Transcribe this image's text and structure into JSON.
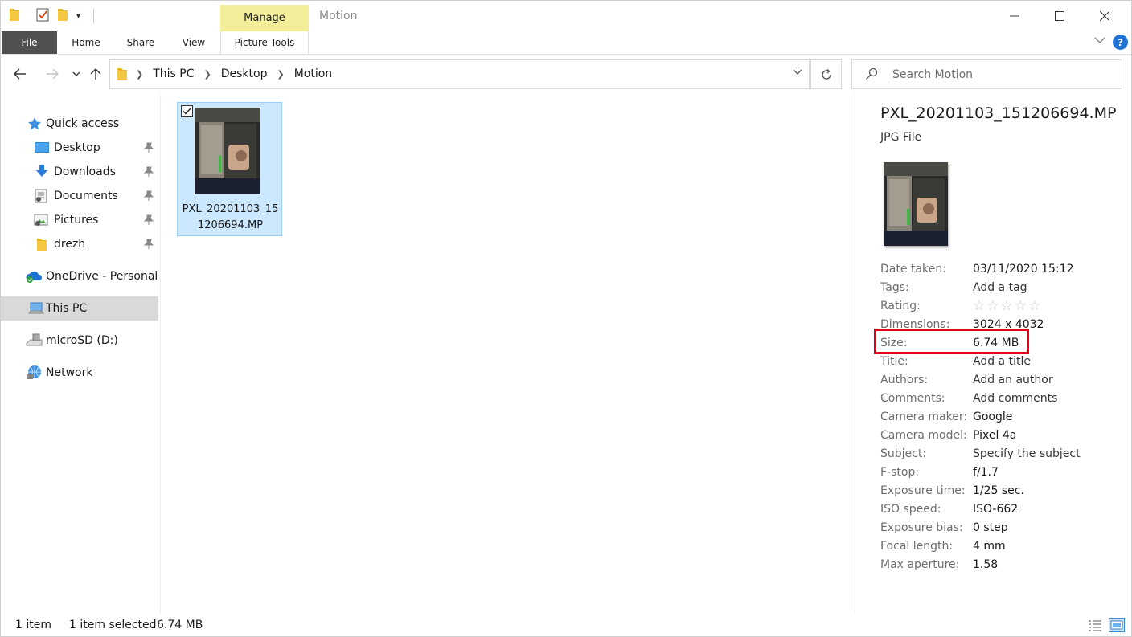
{
  "window": {
    "title": "Motion",
    "manage_label": "Manage"
  },
  "ribbon": {
    "file": "File",
    "home": "Home",
    "share": "Share",
    "view": "View",
    "picture_tools": "Picture Tools"
  },
  "address": {
    "crumbs": [
      "This PC",
      "Desktop",
      "Motion"
    ]
  },
  "search": {
    "placeholder": "Search Motion"
  },
  "sidebar": {
    "items": [
      {
        "label": "Quick access",
        "icon": "star-icon"
      },
      {
        "label": "Desktop",
        "icon": "desktop-folder-icon",
        "pinned": true
      },
      {
        "label": "Downloads",
        "icon": "download-arrow-icon",
        "pinned": true
      },
      {
        "label": "Documents",
        "icon": "documents-icon",
        "pinned": true
      },
      {
        "label": "Pictures",
        "icon": "pictures-icon",
        "pinned": true
      },
      {
        "label": "drezh",
        "icon": "folder-icon",
        "pinned": true
      },
      {
        "label": "OneDrive - Personal",
        "icon": "onedrive-cloud-icon"
      },
      {
        "label": "This PC",
        "icon": "computer-icon",
        "selected": true
      },
      {
        "label": "microSD (D:)",
        "icon": "drive-icon"
      },
      {
        "label": "Network",
        "icon": "network-icon"
      }
    ]
  },
  "files": [
    {
      "name": "PXL_20201103_151206694.MP",
      "selected": true,
      "checked": true
    }
  ],
  "details": {
    "title": "PXL_20201103_151206694.MP",
    "type": "JPG File",
    "properties": [
      {
        "key": "Date taken:",
        "value": "03/11/2020 15:12"
      },
      {
        "key": "Tags:",
        "value": "Add a tag"
      },
      {
        "key": "Rating:",
        "value": ""
      },
      {
        "key": "Dimensions:",
        "value": "3024 x 4032"
      },
      {
        "key": "Size:",
        "value": "6.74 MB"
      },
      {
        "key": "Title:",
        "value": "Add a title"
      },
      {
        "key": "Authors:",
        "value": "Add an author"
      },
      {
        "key": "Comments:",
        "value": "Add comments"
      },
      {
        "key": "Camera maker:",
        "value": "Google"
      },
      {
        "key": "Camera model:",
        "value": "Pixel 4a"
      },
      {
        "key": "Subject:",
        "value": "Specify the subject"
      },
      {
        "key": "F-stop:",
        "value": "f/1.7"
      },
      {
        "key": "Exposure time:",
        "value": "1/25 sec."
      },
      {
        "key": "ISO speed:",
        "value": "ISO-662"
      },
      {
        "key": "Exposure bias:",
        "value": "0 step"
      },
      {
        "key": "Focal length:",
        "value": "4 mm"
      },
      {
        "key": "Max aperture:",
        "value": "1.58"
      }
    ],
    "rating_stars": 0
  },
  "status": {
    "item_count": "1 item",
    "selection": "1 item selected",
    "selection_size": "6.74 MB"
  },
  "colors": {
    "accent": "#1f72d1",
    "selection_bg": "#cce8ff",
    "manage_tab": "#f2ee9a",
    "highlight_box": "#e2001a"
  }
}
